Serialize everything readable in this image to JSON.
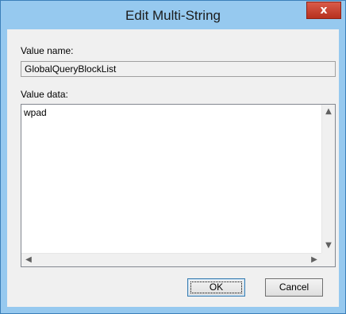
{
  "window": {
    "title": "Edit Multi-String",
    "close_glyph": "x"
  },
  "value_name": {
    "label": "Value name:",
    "value": "GlobalQueryBlockList"
  },
  "value_data": {
    "label": "Value data:",
    "text": "wpad"
  },
  "buttons": {
    "ok": "OK",
    "cancel": "Cancel"
  },
  "icons": {
    "close": "close-icon",
    "scroll_up": "chevron-up-icon",
    "scroll_down": "chevron-down-icon",
    "scroll_left": "chevron-left-icon",
    "scroll_right": "chevron-right-icon"
  },
  "colors": {
    "frame": "#96c9ef",
    "close_button": "#c43c2a",
    "dialog_background": "#f0f0f0"
  }
}
